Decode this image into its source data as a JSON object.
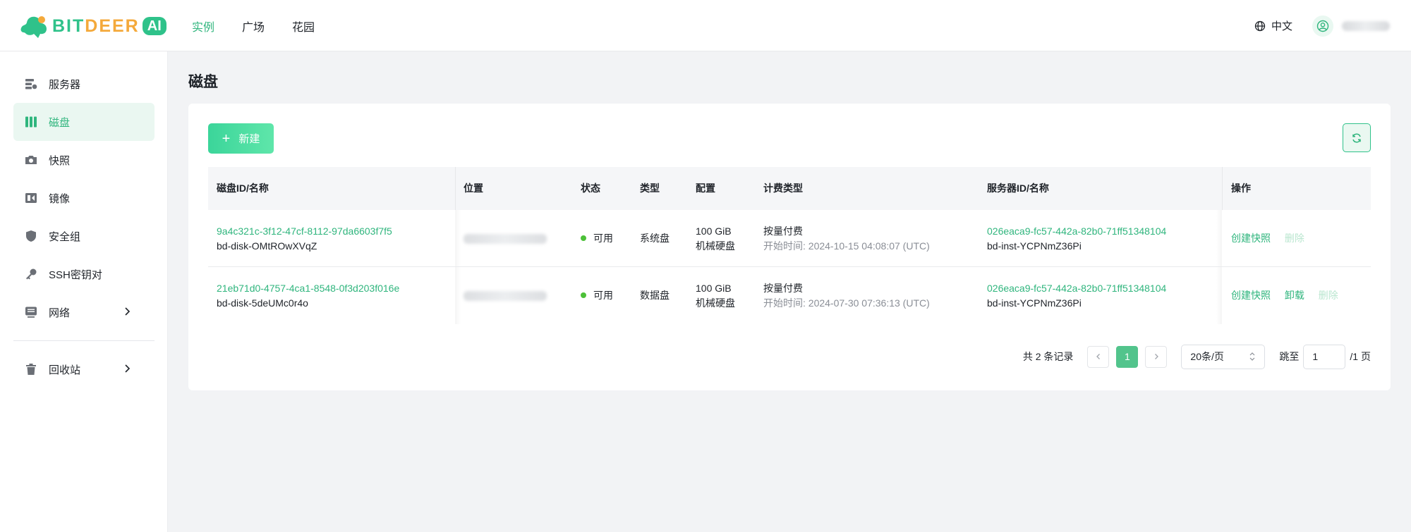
{
  "brand": {
    "part1": "BIT",
    "part2": "DEER",
    "badge": "AI"
  },
  "topnav": {
    "items": [
      {
        "label": "实例",
        "active": true
      },
      {
        "label": "广场"
      },
      {
        "label": "花园"
      }
    ]
  },
  "header_right": {
    "language": "中文"
  },
  "sidebar": {
    "items": [
      {
        "label": "服务器",
        "icon": "server-icon"
      },
      {
        "label": "磁盘",
        "icon": "disk-icon",
        "active": true
      },
      {
        "label": "快照",
        "icon": "camera-icon"
      },
      {
        "label": "镜像",
        "icon": "image-icon"
      },
      {
        "label": "安全组",
        "icon": "shield-icon"
      },
      {
        "label": "SSH密钥对",
        "icon": "key-icon"
      },
      {
        "label": "网络",
        "icon": "network-icon",
        "expandable": true
      },
      {
        "label": "回收站",
        "icon": "trash-icon",
        "expandable": true
      }
    ]
  },
  "page": {
    "title": "磁盘",
    "new_button": "新建",
    "refresh_button": "refresh"
  },
  "table": {
    "columns": [
      "磁盘ID/名称",
      "位置",
      "状态",
      "类型",
      "配置",
      "计费类型",
      "服务器ID/名称",
      "操作"
    ],
    "rows": [
      {
        "disk_id": "9a4c321c-3f12-47cf-8112-97da6603f7f5",
        "disk_name": "bd-disk-OMtROwXVqZ",
        "status": "可用",
        "type": "系统盘",
        "config_size": "100 GiB",
        "config_media": "机械硬盘",
        "billing": "按量付费",
        "start_time": "开始时间: 2024-10-15 04:08:07 (UTC)",
        "server_id": "026eaca9-fc57-442a-82b0-71ff51348104",
        "server_name": "bd-inst-YCPNmZ36Pi",
        "actions": [
          "创建快照",
          "删除"
        ]
      },
      {
        "disk_id": "21eb71d0-4757-4ca1-8548-0f3d203f016e",
        "disk_name": "bd-disk-5deUMc0r4o",
        "status": "可用",
        "type": "数据盘",
        "config_size": "100 GiB",
        "config_media": "机械硬盘",
        "billing": "按量付费",
        "start_time": "开始时间: 2024-07-30 07:36:13 (UTC)",
        "server_id": "026eaca9-fc57-442a-82b0-71ff51348104",
        "server_name": "bd-inst-YCPNmZ36Pi",
        "actions": [
          "创建快照",
          "卸载",
          "删除"
        ]
      }
    ]
  },
  "pagination": {
    "total_text": "共 2 条记录",
    "current_page": "1",
    "page_size": "20条/页",
    "jump_label": "跳至",
    "jump_value": "1",
    "total_pages_text": "/1 页"
  },
  "colors": {
    "accent": "#2fb57d",
    "status_available": "#4cc038",
    "disabled_action": "#b9e6cf"
  }
}
